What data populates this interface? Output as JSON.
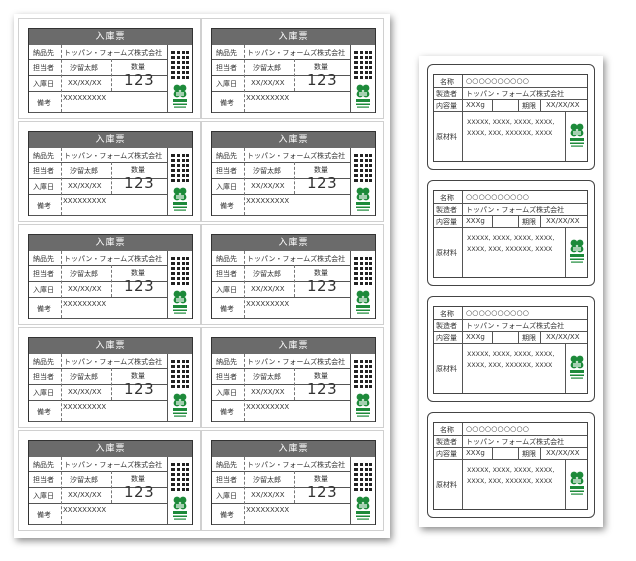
{
  "receipt": {
    "title": "入庫票",
    "delivery_label": "納品先",
    "delivery_value": "トッパン・フォームズ株式会社",
    "person_label": "担当者",
    "person_value": "汐留太郎",
    "date_label": "入庫日",
    "date_value": "XX/XX/XX",
    "qty_label": "数量",
    "qty_value": "123",
    "note_label": "備考",
    "note_value": "XXXXXXXXX"
  },
  "product_label": {
    "name_label": "名称",
    "name_value": "○○○○○○○○○○",
    "maker_label": "製造者",
    "maker_value": "トッパン・フォームズ株式会社",
    "content_label": "内容量",
    "content_value": "XXXg",
    "expiry_label": "期限",
    "expiry_value": "XX/XX/XX",
    "material_label": "原材料",
    "material_line1": "XXXXX, XXXX, XXXX, XXXX,",
    "material_line2": "XXXX, XXX, XXXXXX, XXXX"
  },
  "colors": {
    "header_bg": "#6b6b6b",
    "logo_green": "#1d8a3a"
  },
  "icons": [
    "qr-code-icon",
    "eco-logo-icon"
  ]
}
